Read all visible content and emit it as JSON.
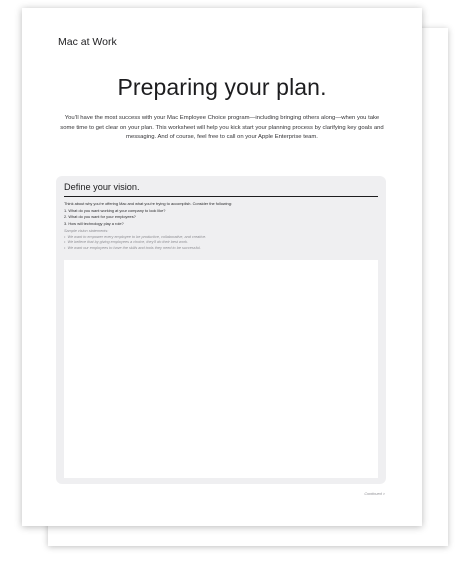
{
  "document": {
    "brand": "Mac at Work",
    "title": "Preparing your plan.",
    "intro": "You’ll have the most success with your Mac Employee Choice program—including bringing others along—when you take some time to get clear on your plan. This worksheet will help you kick start your planning process by clarifying key goals and messaging. And of course, feel free to call on your Apple Enterprise team.",
    "section": {
      "heading": "Define your vision.",
      "prompt_intro": "Think about why you’re offering Mac and what you’re trying to accomplish. Consider the following:",
      "questions": [
        "1. What do you want working at your company to look like?",
        "2. What do you want for your employees?",
        "3. How will technology play a role?"
      ],
      "samples_label": "Sample vision statements:",
      "samples": [
        "We want to empower every employee to be productive, collaborative, and creative.",
        "We believe that by giving employees a choice, they’ll do their best work.",
        "We want our employees to have the skills and tools they need to be successful."
      ]
    },
    "continued": "Continued >"
  }
}
